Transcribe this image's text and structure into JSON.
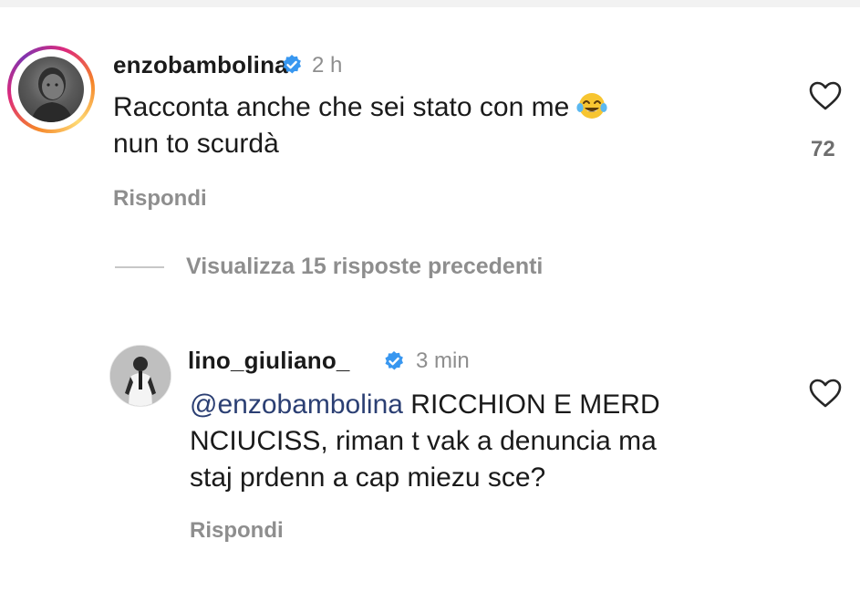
{
  "comments": [
    {
      "username": "enzobambolina",
      "verified": true,
      "time": "2 h",
      "text_line1": "Racconta anche che sei stato con me",
      "emoji": "face-with-tears-of-joy",
      "text_line2": "nun to scurdà",
      "reply_label": "Rispondi",
      "likes": "72"
    },
    {
      "username": "lino_giuliano_",
      "verified": true,
      "time": "3 min",
      "mention": "@enzobambolina",
      "text_line1_rest": " RICCHION E MERD",
      "text_line2": "NCIUCISS, riman t vak a denuncia ma",
      "text_line3": "staj prdenn a cap miezu sce?",
      "reply_label": "Rispondi"
    }
  ],
  "view_replies_label": "Visualizza 15 risposte precedenti",
  "colors": {
    "verified_blue": "#3897f0",
    "secondary_text": "#8e8e8e",
    "mention": "#2b3f73"
  }
}
